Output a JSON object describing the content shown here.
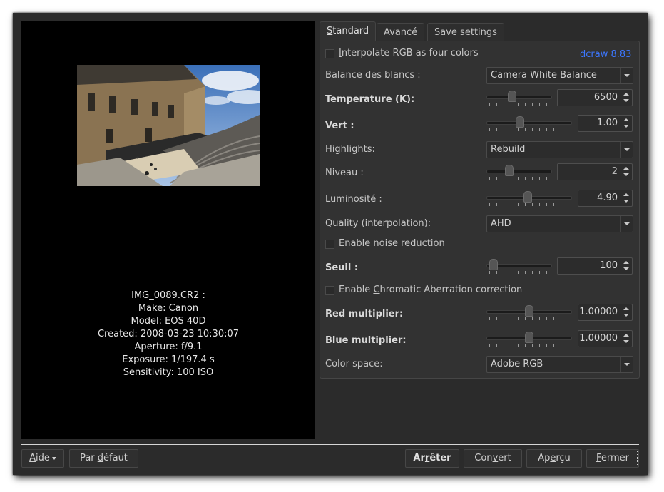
{
  "tabs": [
    {
      "pre": "",
      "u": "S",
      "post": "tandard"
    },
    {
      "pre": "Ava",
      "u": "n",
      "post": "cé"
    },
    {
      "pre": "Save se",
      "u": "t",
      "post": "tings"
    }
  ],
  "file_info": [
    "IMG_0089.CR2 :",
    "Make: Canon",
    "Model: EOS 40D",
    "Created: 2008-03-23 10:30:07",
    "Aperture: f/9.1",
    "Exposure: 1/197.4 s",
    "Sensitivity: 100 ISO"
  ],
  "settings": {
    "interpolate": {
      "u": "I",
      "rest": "nterpolate RGB as four colors",
      "checked": false
    },
    "dcraw_link": "dcraw 8.83",
    "white_balance": {
      "label": "Balance des blancs :",
      "value": "Camera White Balance"
    },
    "temperature": {
      "label": "Temperature (K):",
      "value": "6500",
      "level": 0.38
    },
    "green": {
      "label": "Vert :",
      "value": "1.00",
      "level": 0.38
    },
    "highlights": {
      "label": "Highlights:",
      "value": "Rebuild"
    },
    "level": {
      "label": "Niveau :",
      "value": "2",
      "level": 0.32
    },
    "brightness": {
      "label": "Luminosité :",
      "value": "4.90",
      "level": 0.48
    },
    "quality": {
      "label": "Quality (interpolation):",
      "value": "AHD"
    },
    "noise_reduction": {
      "u": "E",
      "rest": "nable noise reduction",
      "checked": false
    },
    "threshold": {
      "label": "Seuil :",
      "value": "100",
      "level": 0.05
    },
    "chromatic": {
      "pre": "Enable ",
      "u": "C",
      "post": "hromatic Aberration correction",
      "checked": false
    },
    "red_multiplier": {
      "label": "Red multiplier:",
      "value": "1.00000",
      "level": 0.5
    },
    "blue_multiplier": {
      "label": "Blue multiplier:",
      "value": "1.00000",
      "level": 0.5
    },
    "color_space": {
      "label": "Color space:",
      "value": "Adobe RGB"
    }
  },
  "buttons": {
    "help": {
      "u": "A",
      "rest": "ide"
    },
    "default": {
      "pre": "Par ",
      "u": "d",
      "post": "éfaut"
    },
    "stop": {
      "pre": "Ar",
      "u": "r",
      "post": "êter"
    },
    "convert": {
      "pre": "Con",
      "u": "v",
      "post": "ert"
    },
    "preview": {
      "pre": "Ap",
      "u": "e",
      "post": "rçu"
    },
    "close": {
      "u": "F",
      "rest": "ermer"
    }
  }
}
